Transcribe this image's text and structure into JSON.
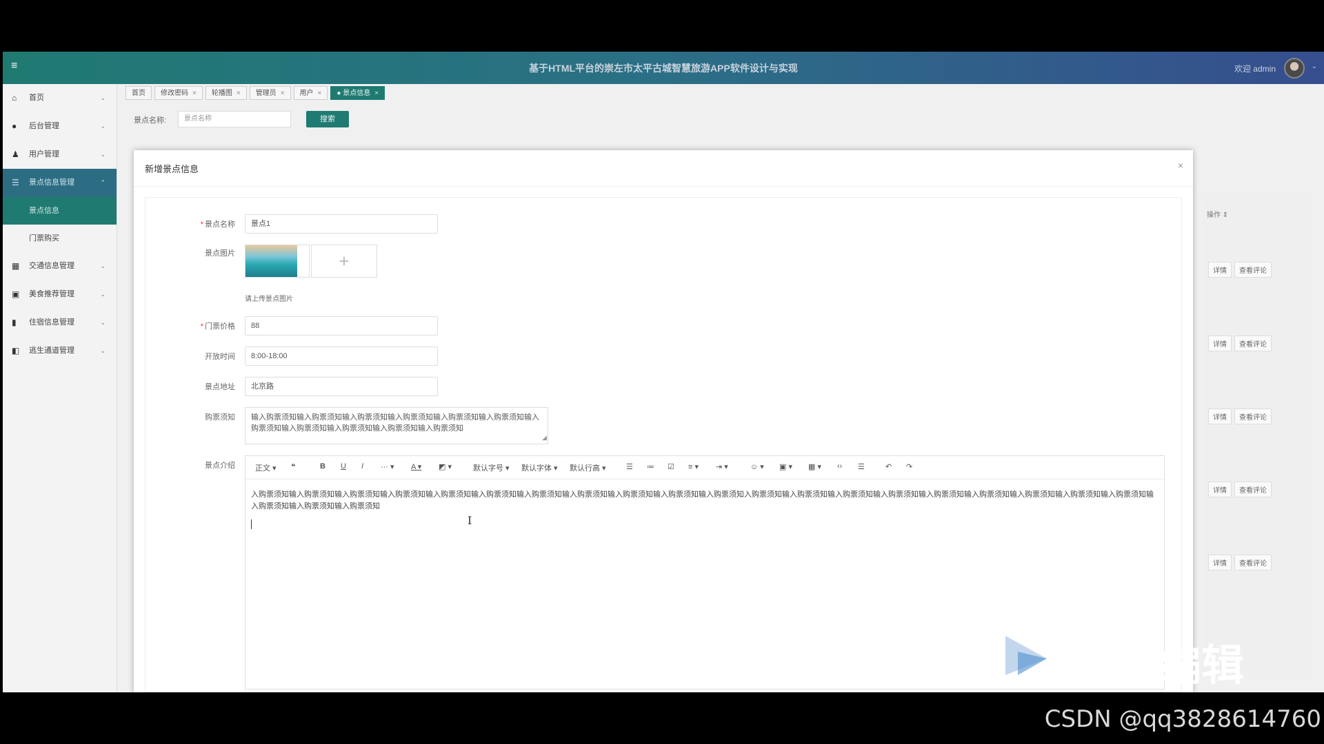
{
  "header": {
    "title": "基于HTML平台的崇左市太平古城智慧旅游APP软件设计与实现",
    "welcome": "欢迎 admin"
  },
  "tabs": [
    {
      "label": "首页",
      "closable": false,
      "active": false
    },
    {
      "label": "修改密码",
      "closable": true,
      "active": false
    },
    {
      "label": "轮播图",
      "closable": true,
      "active": false
    },
    {
      "label": "管理员",
      "closable": true,
      "active": false
    },
    {
      "label": "用户",
      "closable": true,
      "active": false
    },
    {
      "label": "● 景点信息",
      "closable": true,
      "active": true
    }
  ],
  "sidebar": {
    "items": [
      {
        "label": "首页",
        "icon": "home-icon"
      },
      {
        "label": "后台管理",
        "icon": "gear-icon"
      },
      {
        "label": "用户管理",
        "icon": "user-icon"
      },
      {
        "label": "景点信息管理",
        "icon": "database-icon",
        "active": true
      },
      {
        "label": "景点信息",
        "sub": true,
        "active": true
      },
      {
        "label": "门票购买",
        "sub": true
      },
      {
        "label": "交通信息管理",
        "icon": "grid-icon"
      },
      {
        "label": "美食推荐管理",
        "icon": "card-icon"
      },
      {
        "label": "住宿信息管理",
        "icon": "book-icon"
      },
      {
        "label": "逃生通道管理",
        "icon": "door-icon"
      }
    ]
  },
  "filter": {
    "label": "景点名称:",
    "placeholder": "景点名称",
    "search_label": "搜索"
  },
  "background_table": {
    "header": "操作 ⇕",
    "detail_label": "详情",
    "comment_label": "查看评论"
  },
  "modal": {
    "title": "新增景点信息",
    "close": "×",
    "fields": {
      "name_label": "景点名称",
      "name_value": "景点1",
      "image_label": "景点图片",
      "image_hint": "请上传景点图片",
      "price_label": "门票价格",
      "price_value": "88",
      "hours_label": "开放时间",
      "hours_value": "8:00-18:00",
      "address_label": "景点地址",
      "address_value": "北京路",
      "notice_label": "购票须知",
      "notice_value": "输入购票须知输入购票须知输入购票须知输入购票须知输入购票须知输入购票须知输入购票须知输入购票须知输入购票须知输入购票须知输入购票须知",
      "intro_label": "景点介绍",
      "intro_value": "入购票须知输入购票须知输入购票须知输入购票须知输入购票须知输入购票须知输入购票须知输入购票须知输入购票须知输入购票须知输入购票须知入购票须知输入购票须知输入购票须知输入购票须知输入购票须知输入购票须知输入购票须知输入购票须知输入购票须知输入购票须知输入购票须知输入购票须知"
    },
    "toolbar": {
      "paragraph": "正文",
      "font_size": "默认字号",
      "font_family": "默认字体",
      "line_height": "默认行高"
    }
  },
  "watermark": {
    "text": "编辑",
    "csdn": "CSDN @qq3828614760"
  }
}
